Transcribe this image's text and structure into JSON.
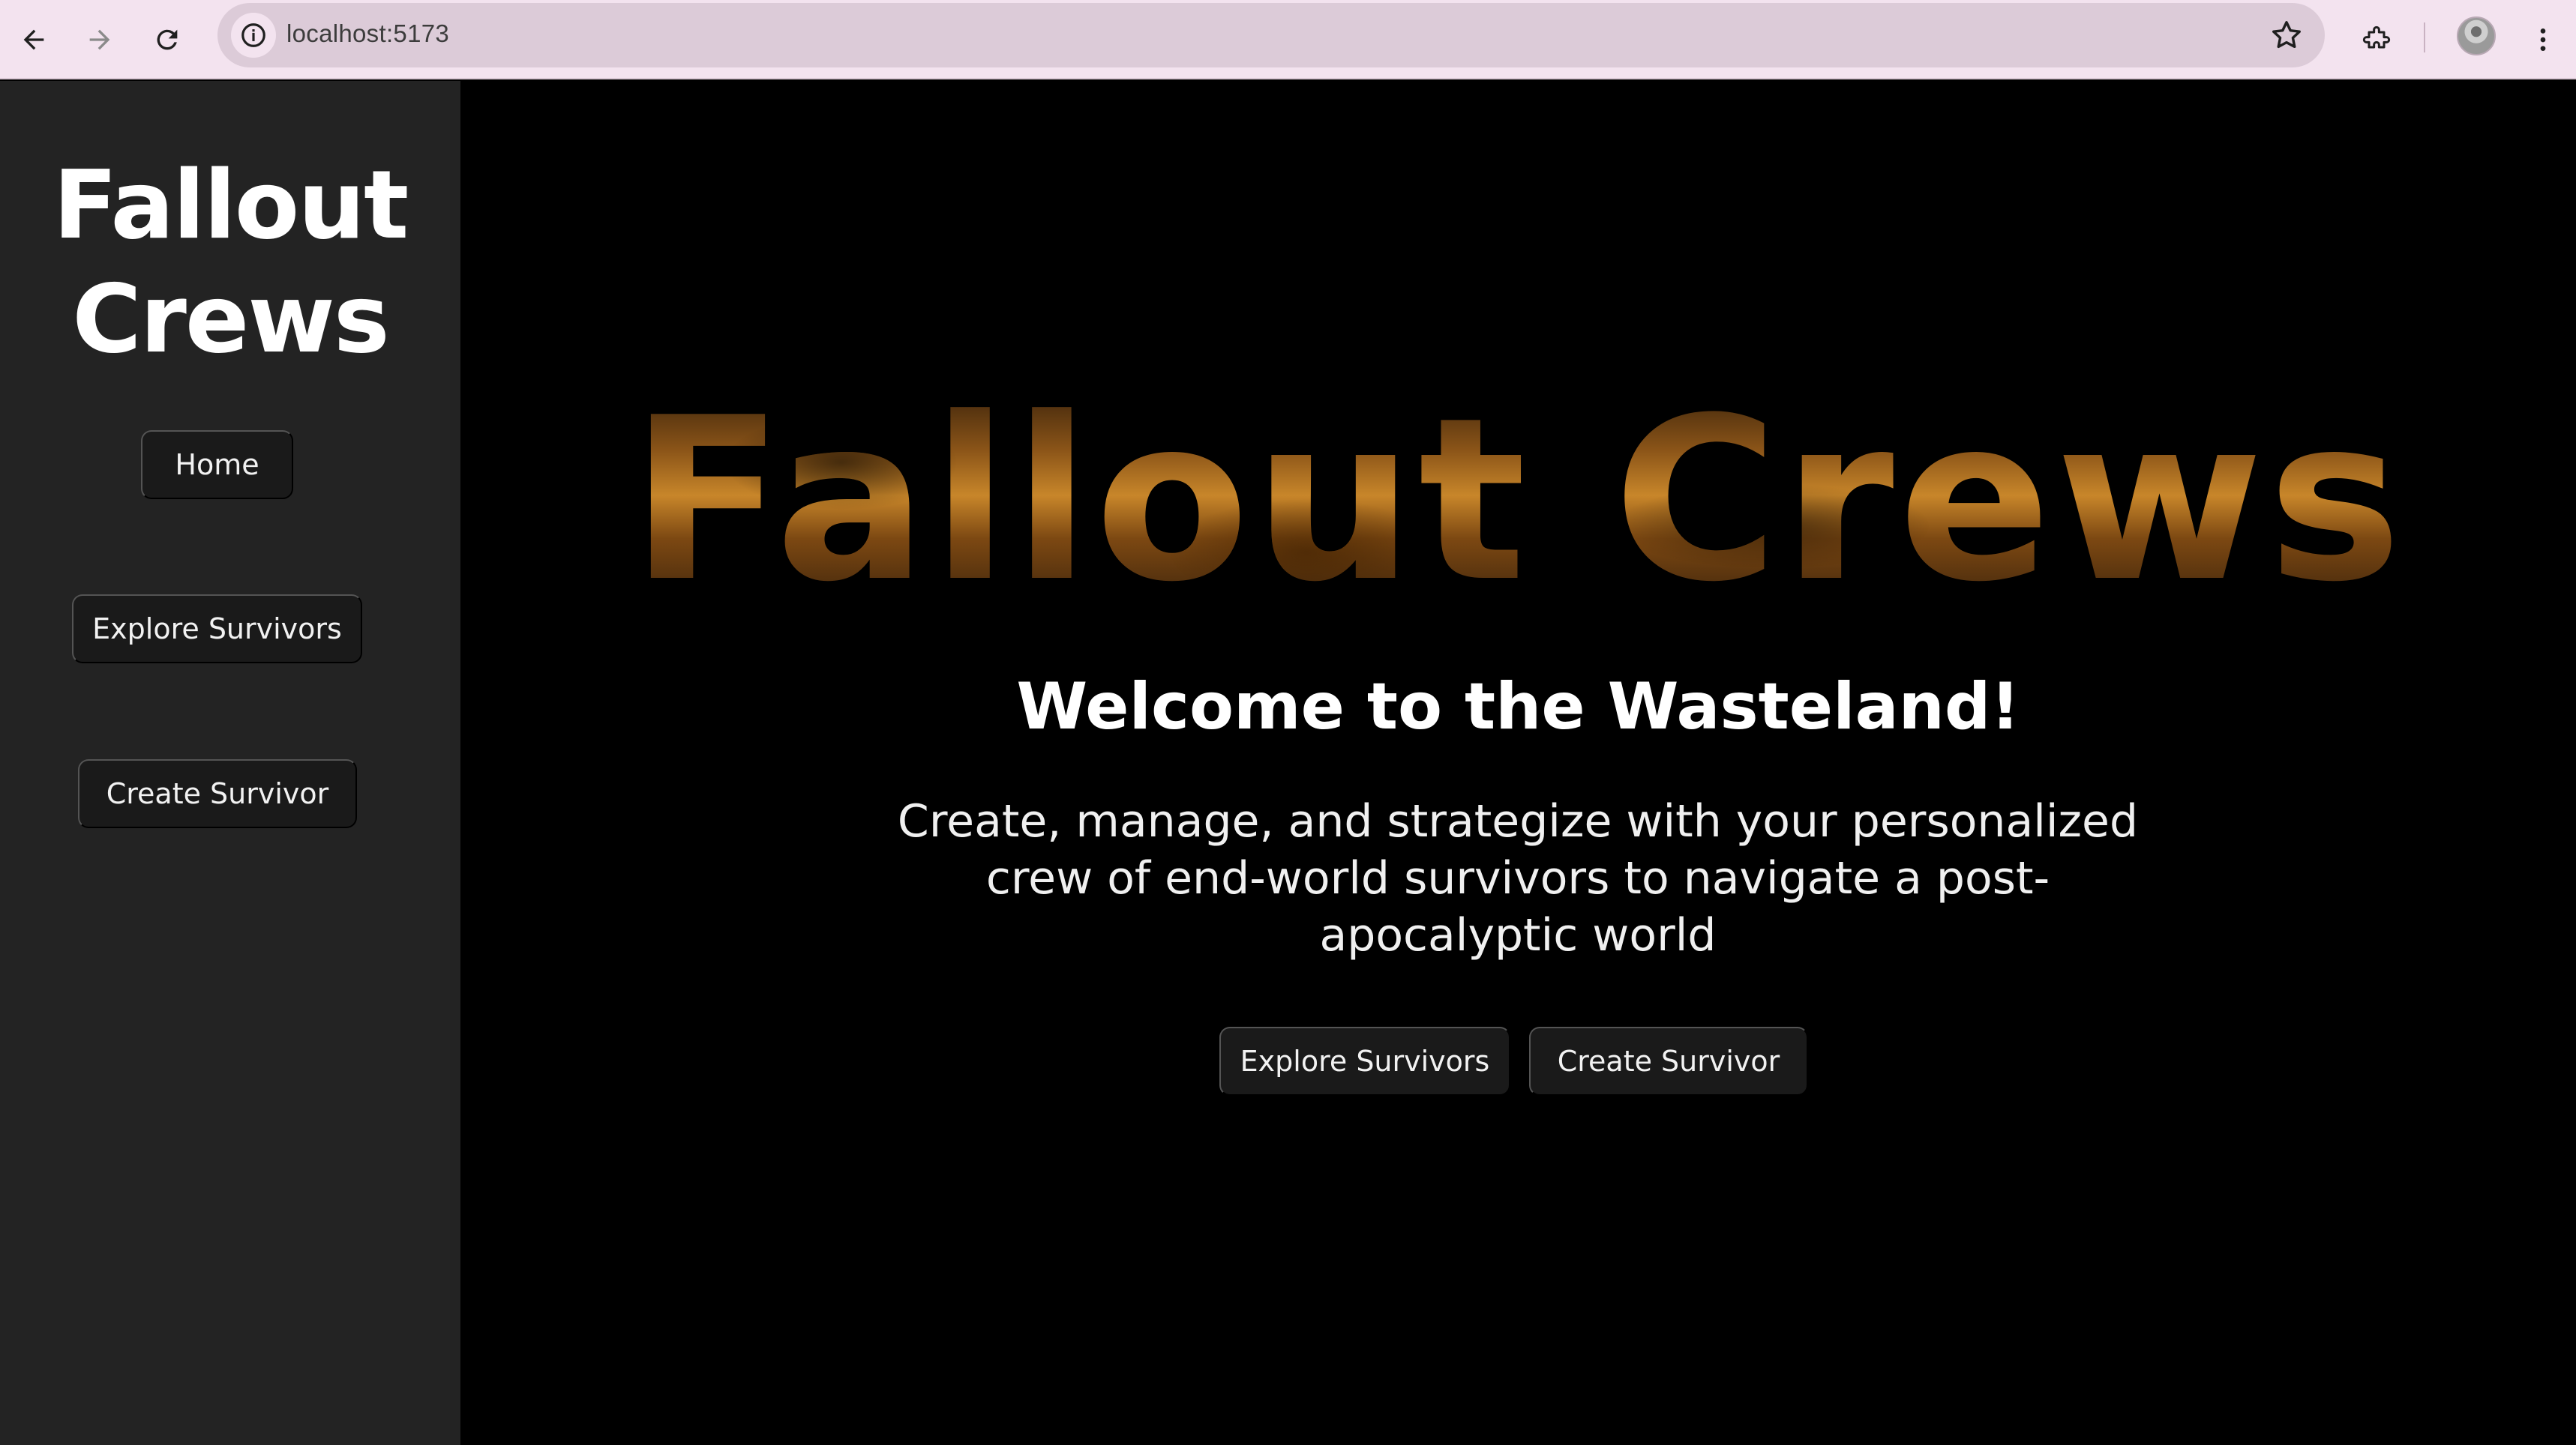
{
  "browser": {
    "url": "localhost:5173",
    "icons": {
      "back": "back-arrow-icon",
      "forward": "forward-arrow-icon",
      "reload": "reload-icon",
      "site_info": "info-icon",
      "bookmark": "star-icon",
      "extensions": "puzzle-icon",
      "menu": "kebab-menu-icon"
    }
  },
  "sidebar": {
    "brand": "Fallout Crews",
    "nav": [
      {
        "label": "Home"
      },
      {
        "label": "Explore Survivors"
      },
      {
        "label": "Create Survivor"
      }
    ]
  },
  "main": {
    "hero_title": "Fallout Crews",
    "welcome": "Welcome to the Wasteland!",
    "tagline": "Create, manage, and strategize with your personalized crew of end-world survivors to navigate a post-apocalyptic world",
    "actions": [
      {
        "label": "Explore Survivors"
      },
      {
        "label": "Create Survivor"
      }
    ]
  },
  "colors": {
    "sidebar_bg": "#232323",
    "main_bg": "#000000",
    "button_bg": "#1a1a1a",
    "chrome_bg": "#f3e3ef",
    "hero_gradient": [
      "#2a1808",
      "#c8862a"
    ]
  }
}
